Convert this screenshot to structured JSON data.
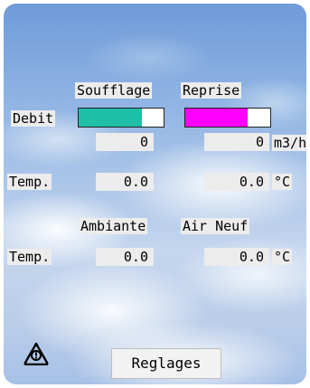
{
  "headers": {
    "soufflage": "Soufflage",
    "reprise": "Reprise",
    "ambiante": "Ambiante",
    "air_neuf": "Air Neuf"
  },
  "rows": {
    "debit_label": "Debit",
    "temp_label_1": "Temp.",
    "temp_label_2": "Temp."
  },
  "debit": {
    "soufflage_value": "0",
    "reprise_value": "0",
    "unit": "m3/h",
    "soufflage_fill": 0.74,
    "reprise_fill": 0.73,
    "soufflage_color": "#1fbfa8",
    "reprise_color": "#ff00ff"
  },
  "temperature": {
    "soufflage_value": "0.0",
    "reprise_value": "0.0",
    "ambiante_value": "0.0",
    "air_neuf_value": "0.0",
    "unit": "°C"
  },
  "actions": {
    "reglages_label": "Reglages"
  },
  "icons": {
    "alarm": "warning-triangle-icon"
  }
}
